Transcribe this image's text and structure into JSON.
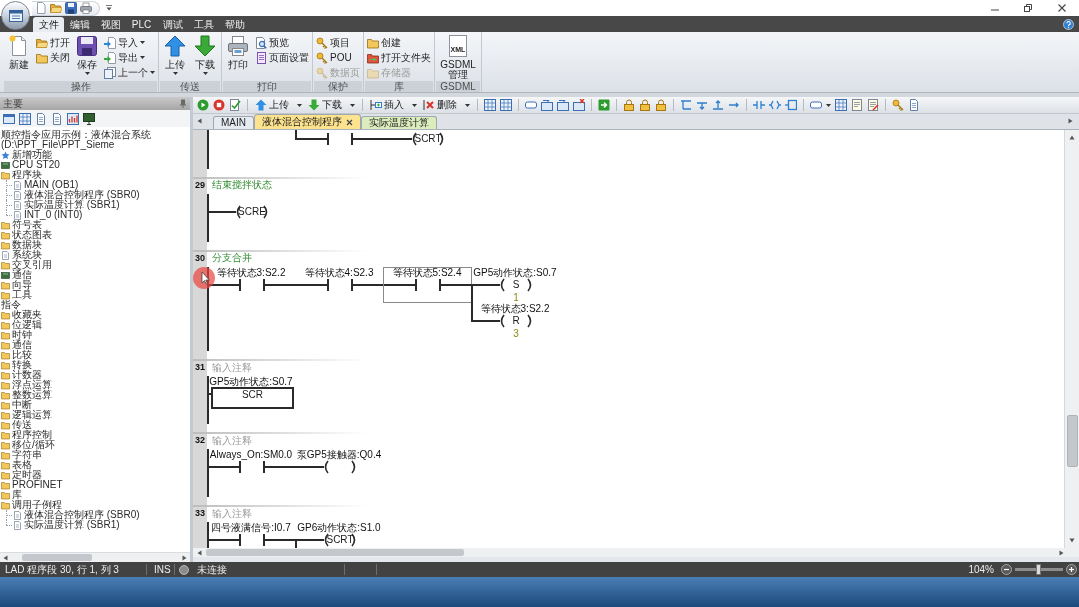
{
  "menu_tabs": [
    {
      "label": "文件",
      "selected": true
    },
    {
      "label": "编辑",
      "selected": false
    },
    {
      "label": "视图",
      "selected": false
    },
    {
      "label": "PLC",
      "selected": false
    },
    {
      "label": "调试",
      "selected": false
    },
    {
      "label": "工具",
      "selected": false
    },
    {
      "label": "帮助",
      "selected": false
    }
  ],
  "ribbon": {
    "groups": [
      {
        "label": "操作",
        "items": [
          {
            "label": "新建",
            "kind": "large",
            "dropdown": false,
            "disabled": false
          },
          {
            "label": "打开",
            "kind": "small",
            "dropdown": false,
            "disabled": false
          },
          {
            "label": "关闭",
            "kind": "small",
            "dropdown": false,
            "disabled": false
          },
          {
            "label": "保存",
            "kind": "large",
            "dropdown": true,
            "disabled": false
          },
          {
            "label": "导入",
            "kind": "small",
            "dropdown": true,
            "disabled": false
          },
          {
            "label": "导出",
            "kind": "small",
            "dropdown": true,
            "disabled": false
          },
          {
            "label": "上一个",
            "kind": "small",
            "dropdown": true,
            "disabled": false
          }
        ]
      },
      {
        "label": "传送",
        "items": [
          {
            "label": "上传",
            "kind": "large",
            "dropdown": true,
            "disabled": false
          },
          {
            "label": "下载",
            "kind": "large",
            "dropdown": true,
            "disabled": false
          }
        ]
      },
      {
        "label": "打印",
        "items": [
          {
            "label": "打印",
            "kind": "large",
            "dropdown": false,
            "disabled": false
          },
          {
            "label": "预览",
            "kind": "small",
            "dropdown": false,
            "disabled": false
          },
          {
            "label": "页面设置",
            "kind": "small",
            "dropdown": false,
            "disabled": false
          }
        ]
      },
      {
        "label": "保护",
        "items": [
          {
            "label": "项目",
            "kind": "small",
            "dropdown": false,
            "disabled": false
          },
          {
            "label": "POU",
            "kind": "small",
            "dropdown": false,
            "disabled": false
          },
          {
            "label": "数据页",
            "kind": "small",
            "dropdown": false,
            "disabled": true
          }
        ]
      },
      {
        "label": "库",
        "items": [
          {
            "label": "创建",
            "kind": "small",
            "dropdown": false,
            "disabled": false
          },
          {
            "label": "打开文件夹",
            "kind": "small",
            "dropdown": false,
            "disabled": false
          },
          {
            "label": "存储器",
            "kind": "small",
            "dropdown": false,
            "disabled": true
          }
        ]
      },
      {
        "label": "GSDML",
        "items": [
          {
            "label": "GSDML管理",
            "kind": "large",
            "dropdown": false,
            "disabled": false,
            "icon_label": "XML"
          }
        ]
      }
    ]
  },
  "project_panel": {
    "title": "主要",
    "tree": [
      {
        "label": "顺控指令应用示例：液体混合系统 (D:\\PPT_File\\PPT_Sieme",
        "children": [
          {
            "label": "新增功能",
            "kind": "info"
          },
          {
            "label": "CPU ST20",
            "kind": "cpu"
          },
          {
            "label": "程序块",
            "kind": "folder",
            "children": [
              {
                "label": "MAIN (OB1)",
                "kind": "doc"
              },
              {
                "label": "液体混合控制程序 (SBR0)",
                "kind": "doc"
              },
              {
                "label": "实际温度计算 (SBR1)",
                "kind": "doc"
              },
              {
                "label": "INT_0 (INT0)",
                "kind": "doc"
              }
            ]
          },
          {
            "label": "符号表",
            "kind": "folder"
          },
          {
            "label": "状态图表",
            "kind": "folder"
          },
          {
            "label": "数据块",
            "kind": "folder"
          },
          {
            "label": "系统块",
            "kind": "doc"
          },
          {
            "label": "交叉引用",
            "kind": "folder"
          },
          {
            "label": "通信",
            "kind": "cpu"
          },
          {
            "label": "向导",
            "kind": "folder"
          },
          {
            "label": "工具",
            "kind": "folder"
          }
        ]
      },
      {
        "label": "指令",
        "children": [
          {
            "label": "收藏夹",
            "kind": "folder"
          },
          {
            "label": "位逻辑",
            "kind": "folder"
          },
          {
            "label": "时钟",
            "kind": "folder"
          },
          {
            "label": "通信",
            "kind": "folder"
          },
          {
            "label": "比较",
            "kind": "folder"
          },
          {
            "label": "转换",
            "kind": "folder"
          },
          {
            "label": "计数器",
            "kind": "folder"
          },
          {
            "label": "浮点运算",
            "kind": "folder"
          },
          {
            "label": "整数运算",
            "kind": "folder"
          },
          {
            "label": "中断",
            "kind": "folder"
          },
          {
            "label": "逻辑运算",
            "kind": "folder"
          },
          {
            "label": "传送",
            "kind": "folder"
          },
          {
            "label": "程序控制",
            "kind": "folder"
          },
          {
            "label": "移位/循环",
            "kind": "folder"
          },
          {
            "label": "字符串",
            "kind": "folder"
          },
          {
            "label": "表格",
            "kind": "folder"
          },
          {
            "label": "定时器",
            "kind": "folder"
          },
          {
            "label": "PROFINET",
            "kind": "folder"
          },
          {
            "label": "库",
            "kind": "folder"
          },
          {
            "label": "调用子例程",
            "kind": "folder",
            "children": [
              {
                "label": "液体混合控制程序 (SBR0)",
                "kind": "doc"
              },
              {
                "label": "实际温度计算 (SBR1)",
                "kind": "doc"
              }
            ]
          }
        ]
      }
    ]
  },
  "editor": {
    "toolbar": [
      {
        "label": "上传",
        "dropdown": true
      },
      {
        "label": "下载",
        "dropdown": true
      },
      {
        "label": "插入",
        "dropdown": true
      },
      {
        "label": "删除",
        "dropdown": true
      }
    ],
    "tabs": [
      {
        "label": "MAIN",
        "selected": false,
        "color": "#e6ebf1"
      },
      {
        "label": "液体混合控制程序",
        "selected": true,
        "color": "#fde38d"
      },
      {
        "label": "实际温度计算",
        "selected": false,
        "color": "#dcedbd"
      }
    ],
    "networks": [
      {
        "cells": [
          {
            "kind": "empty",
            "selected": false,
            "joined_above": false,
            "joined_below": false
          },
          {
            "kind": "contact",
            "selected": false,
            "joined_above": true,
            "joined_below": false
          },
          {
            "kind": "coil",
            "instruction": "SCRT",
            "selected": false,
            "joined_above": false,
            "joined_below": false
          }
        ]
      },
      {
        "number": "29",
        "comment": "结束搅拌状态",
        "cells": [
          {
            "kind": "coil",
            "instruction": "SCRE",
            "selected": false,
            "joined_above": false,
            "joined_below": false
          }
        ]
      },
      {
        "number": "30",
        "comment": "分支合并",
        "cells": [
          {
            "kind": "contact",
            "label": "等待状态3:S2.2",
            "selected": false,
            "joined_above": false,
            "joined_below": false
          },
          {
            "kind": "contact",
            "label": "等待状态4:S2.3",
            "selected": false,
            "joined_above": false,
            "joined_below": false
          },
          {
            "kind": "contact",
            "label": "等待状态5:S2.4",
            "selected": true,
            "joined_above": false,
            "joined_below": false
          },
          {
            "kind": "outputs",
            "selected": false,
            "joined_above": false,
            "joined_below": false,
            "coils": [
              {
                "label": "GP5动作状态:S0.7",
                "instruction": "S",
                "count": "1"
              },
              {
                "label": "等待状态3:S2.2",
                "instruction": "R",
                "count": "3"
              }
            ]
          }
        ]
      },
      {
        "number": "31",
        "placeholder": "输入注释",
        "cells": [
          {
            "kind": "box",
            "label": "GP5动作状态:S0.7",
            "instruction": "SCR",
            "selected": false,
            "joined_above": false,
            "joined_below": false
          }
        ]
      },
      {
        "number": "32",
        "placeholder": "输入注释",
        "cells": [
          {
            "kind": "contact",
            "label": "Always_On:SM0.0",
            "selected": false,
            "joined_above": false,
            "joined_below": false
          },
          {
            "kind": "coil",
            "label": "泵GP5接触器:Q0.4",
            "selected": false,
            "joined_above": false,
            "joined_below": false
          }
        ]
      },
      {
        "number": "33",
        "placeholder": "输入注释",
        "cells": [
          {
            "kind": "contact",
            "label": "四号液满信号:I0.7",
            "selected": false,
            "joined_above": false,
            "joined_below": false
          },
          {
            "kind": "coil",
            "label": "GP6动作状态:S1.0",
            "instruction": "SCRT",
            "selected": false,
            "joined_above": false,
            "joined_below": true
          }
        ]
      }
    ]
  },
  "status_bar": {
    "position": "LAD 程序段 30, 行 1, 列 3",
    "mode": "INS",
    "connection": "未连接",
    "zoom": "104%",
    "zoom_slider": {
      "level": 0.48
    }
  }
}
